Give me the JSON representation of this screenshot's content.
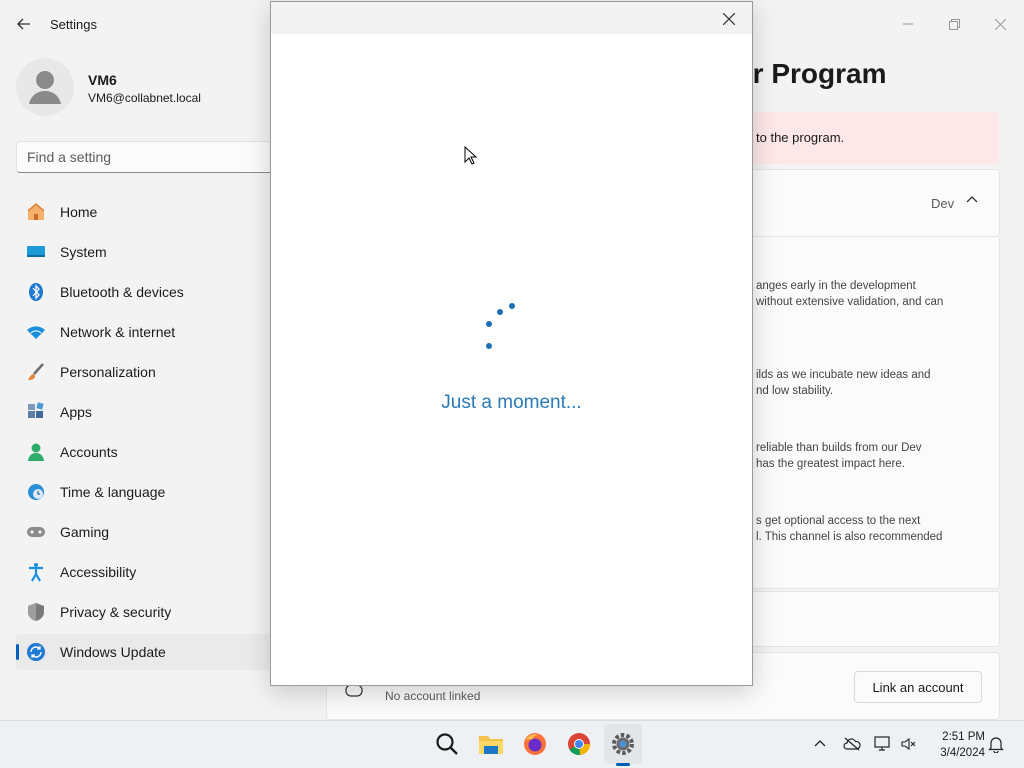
{
  "app": {
    "title": "Settings"
  },
  "profile": {
    "name": "VM6",
    "email": "VM6@collabnet.local"
  },
  "search": {
    "placeholder": "Find a setting"
  },
  "nav": {
    "items": [
      {
        "label": "Home",
        "icon": "home-icon"
      },
      {
        "label": "System",
        "icon": "system-icon"
      },
      {
        "label": "Bluetooth & devices",
        "icon": "bluetooth-icon"
      },
      {
        "label": "Network & internet",
        "icon": "wifi-icon"
      },
      {
        "label": "Personalization",
        "icon": "brush-icon"
      },
      {
        "label": "Apps",
        "icon": "apps-icon"
      },
      {
        "label": "Accounts",
        "icon": "accounts-icon"
      },
      {
        "label": "Time & language",
        "icon": "clock-globe-icon"
      },
      {
        "label": "Gaming",
        "icon": "gamepad-icon"
      },
      {
        "label": "Accessibility",
        "icon": "accessibility-icon"
      },
      {
        "label": "Privacy & security",
        "icon": "shield-icon"
      },
      {
        "label": "Windows Update",
        "icon": "update-icon",
        "active": true
      }
    ]
  },
  "content": {
    "title_fragment": "der Program",
    "warning_fragment": "to the program.",
    "channel_value": "Dev",
    "descriptions": [
      [
        "anges early in the development",
        "without extensive validation, and can"
      ],
      [
        "ilds as we incubate new ideas and",
        "nd low stability."
      ],
      [
        "reliable than builds from our Dev",
        "has the greatest impact here."
      ],
      [
        "s get optional access to the next",
        "l. This channel is also recommended"
      ]
    ],
    "account_status": "No account linked",
    "link_button": "Link an account"
  },
  "dialog": {
    "message": "Just a moment..."
  },
  "taskbar": {
    "apps": [
      "search-icon",
      "file-explorer-icon",
      "firefox-icon",
      "chrome-icon",
      "settings-gear-icon"
    ],
    "time": "2:51 PM",
    "date": "3/4/2024"
  },
  "colors": {
    "accent": "#005fb8",
    "warning_bg": "#fde7e9",
    "spinner": "#1c6fb6"
  }
}
